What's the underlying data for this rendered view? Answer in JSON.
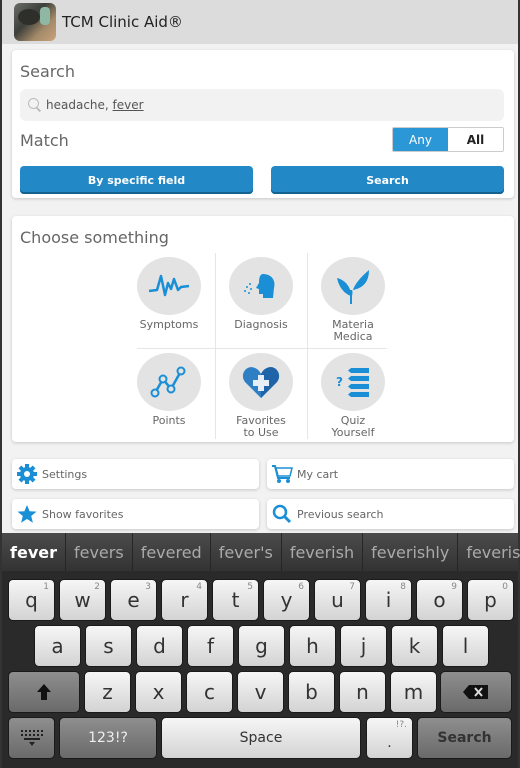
{
  "app": {
    "title": "TCM Clinic Aid®",
    "logo_icon": "herbs-mortar-logo"
  },
  "colors": {
    "accent": "#2c97d6",
    "button_blue": "#2389c6",
    "icon_blue": "#1a8fd6"
  },
  "search_card": {
    "heading": "Search",
    "input_icon": "search-icon",
    "input_value_prefix": "headache, ",
    "input_value_composing": "fever",
    "match_label": "Match",
    "match_options": [
      {
        "label": "Any",
        "selected": true
      },
      {
        "label": "All",
        "selected": false
      }
    ],
    "by_field_button": "By specific field",
    "search_button": "Search"
  },
  "choose_card": {
    "heading": "Choose something",
    "tiles": [
      {
        "label": "Symptoms",
        "icon": "heartbeat-icon"
      },
      {
        "label": "Diagnosis",
        "icon": "head-breath-icon"
      },
      {
        "label": "Materia\nMedica",
        "label_lines": [
          "Materia",
          "Medica"
        ],
        "icon": "leaf-icon"
      },
      {
        "label": "Points",
        "icon": "points-graph-icon"
      },
      {
        "label": "Favorites\nto Use",
        "label_lines": [
          "Favorites",
          "to Use"
        ],
        "icon": "heart-plus-icon"
      },
      {
        "label": "Quiz\nYourself",
        "label_lines": [
          "Quiz",
          "Yourself"
        ],
        "icon": "quiz-list-icon"
      }
    ]
  },
  "actions": [
    {
      "label": "Settings",
      "icon": "gear-icon"
    },
    {
      "label": "My cart",
      "icon": "cart-icon"
    },
    {
      "label": "Show favorites",
      "icon": "star-icon"
    },
    {
      "label": "Previous search",
      "icon": "search-icon"
    }
  ],
  "keyboard": {
    "suggestions": [
      "fever",
      "fevers",
      "fevered",
      "fever's",
      "feverish",
      "feverishly",
      "feverish"
    ],
    "row1": [
      {
        "k": "q",
        "n": "1"
      },
      {
        "k": "w",
        "n": "2"
      },
      {
        "k": "e",
        "n": "3"
      },
      {
        "k": "r",
        "n": "4"
      },
      {
        "k": "t",
        "n": "5"
      },
      {
        "k": "y",
        "n": "6"
      },
      {
        "k": "u",
        "n": "7"
      },
      {
        "k": "i",
        "n": "8"
      },
      {
        "k": "o",
        "n": "9"
      },
      {
        "k": "p",
        "n": "0"
      }
    ],
    "row2": [
      "a",
      "s",
      "d",
      "f",
      "g",
      "h",
      "j",
      "k",
      "l"
    ],
    "row3": [
      "z",
      "x",
      "c",
      "v",
      "b",
      "n",
      "m"
    ],
    "shift_icon": "shift-arrow-icon",
    "backspace_icon": "backspace-icon",
    "keyboard_hide_icon": "keyboard-hide-icon",
    "symbols_label": "123!?",
    "space_label": "Space",
    "period_label": ".",
    "period_alt": "!?.",
    "search_label": "Search"
  }
}
